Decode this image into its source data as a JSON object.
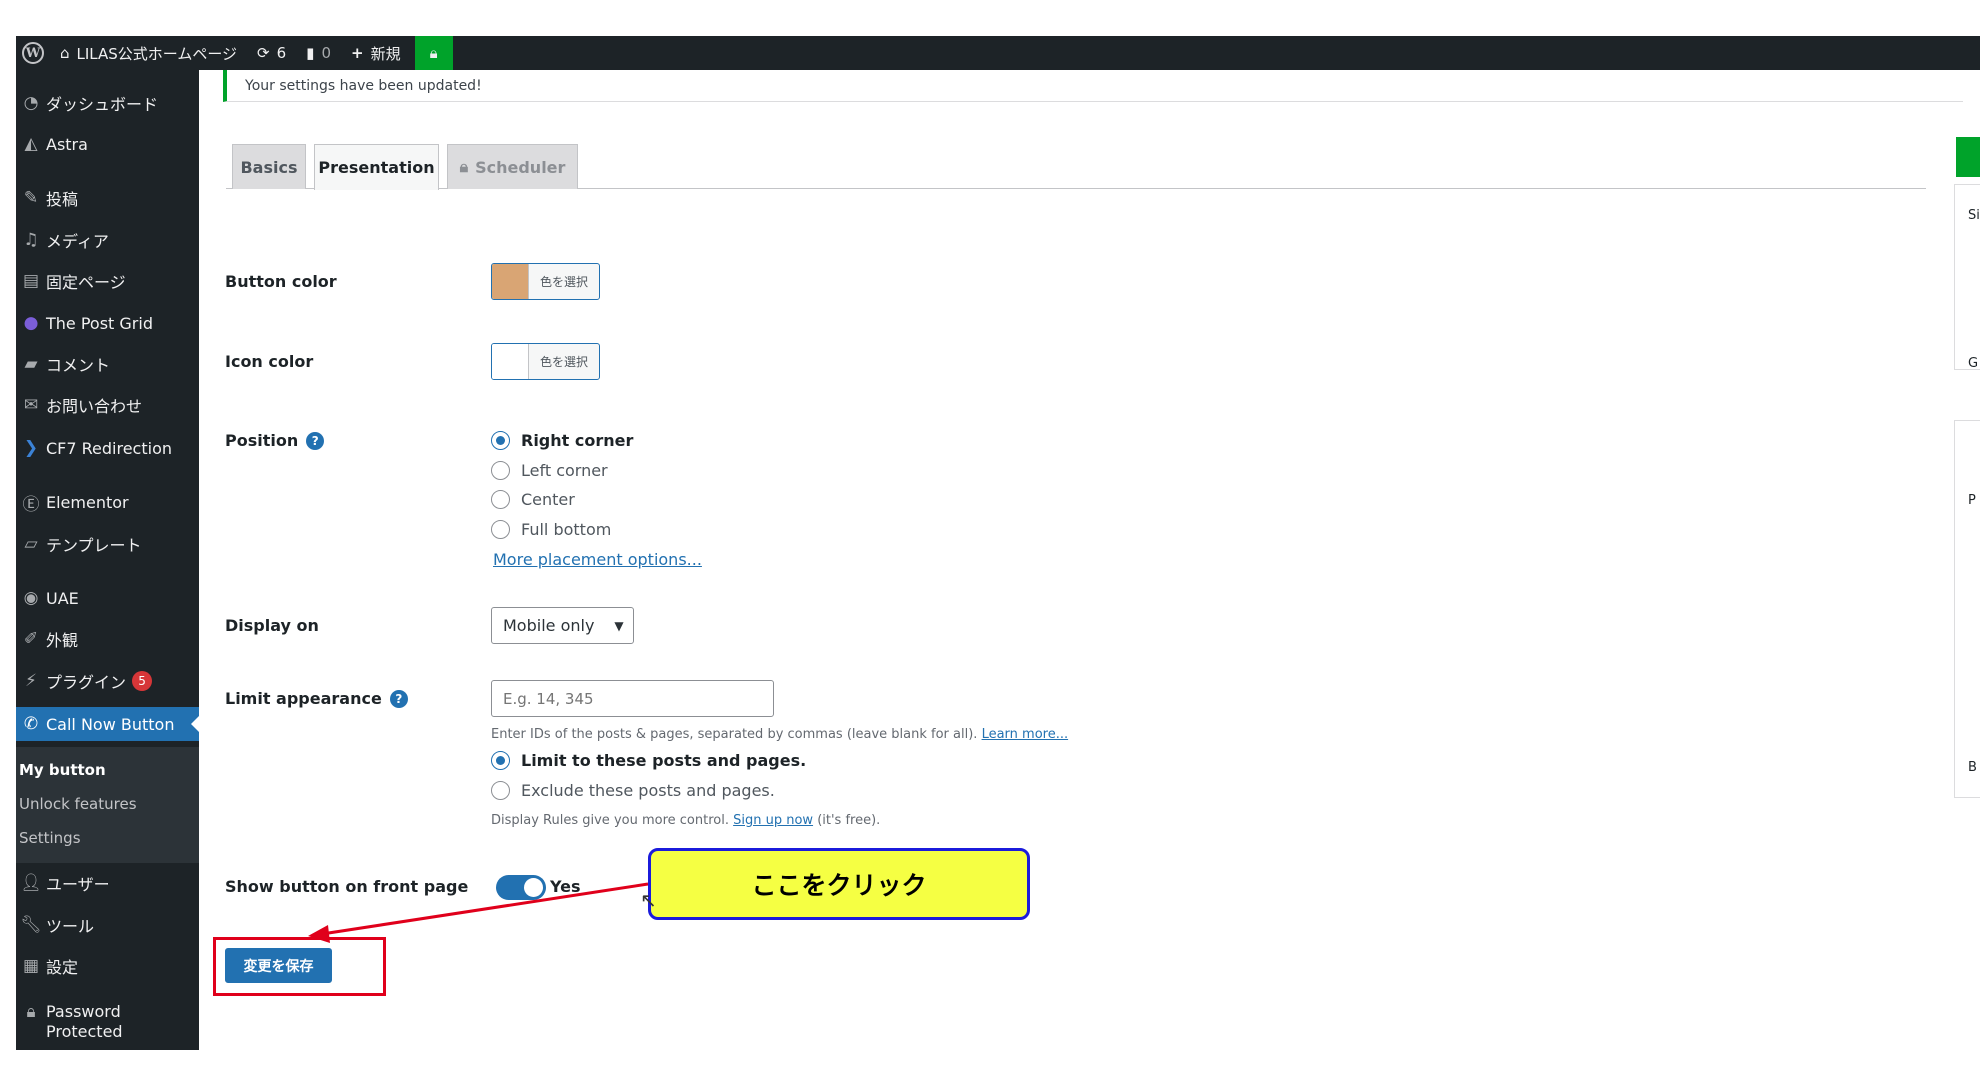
{
  "admin_bar": {
    "site_name": "LILAS公式ホームページ",
    "updates_count": "6",
    "comments_count": "0",
    "new_label": "新規"
  },
  "sidebar": {
    "items": [
      {
        "label": "ダッシュボード",
        "icon": "dashboard-icon"
      },
      {
        "label": "Astra",
        "icon": "astra-icon"
      },
      {
        "label": "投稿",
        "icon": "pin-icon"
      },
      {
        "label": "メディア",
        "icon": "media-icon"
      },
      {
        "label": "固定ページ",
        "icon": "page-icon"
      },
      {
        "label": "The Post Grid",
        "icon": "grid-icon"
      },
      {
        "label": "コメント",
        "icon": "comment-icon"
      },
      {
        "label": "お問い合わせ",
        "icon": "mail-icon"
      },
      {
        "label": "CF7 Redirection",
        "icon": "redirect-icon"
      },
      {
        "label": "Elementor",
        "icon": "elementor-icon"
      },
      {
        "label": "テンプレート",
        "icon": "folder-icon"
      },
      {
        "label": "UAE",
        "icon": "uae-icon"
      },
      {
        "label": "外観",
        "icon": "brush-icon"
      },
      {
        "label": "プラグイン",
        "icon": "plugin-icon",
        "badge": "5"
      },
      {
        "label": "Call Now Button",
        "icon": "phone-icon"
      },
      {
        "label": "ユーザー",
        "icon": "user-icon"
      },
      {
        "label": "ツール",
        "icon": "wrench-icon"
      },
      {
        "label": "設定",
        "icon": "settings-icon"
      },
      {
        "label": "Password Protected",
        "icon": "lock-icon"
      }
    ],
    "submenu": [
      "My button",
      "Unlock features",
      "Settings"
    ]
  },
  "notice": "Your settings have been updated!",
  "tabs": [
    "Basics",
    "Presentation",
    "Scheduler"
  ],
  "form": {
    "button_color_label": "Button color",
    "icon_color_label": "Icon color",
    "color_picker_label": "色を選択",
    "button_color": "#d9a574",
    "icon_color": "#ffffff",
    "position_label": "Position",
    "position_options": [
      "Right corner",
      "Left corner",
      "Center",
      "Full bottom"
    ],
    "position_selected": "Right corner",
    "more_placement": "More placement options...",
    "display_on_label": "Display on",
    "display_on_value": "Mobile only",
    "limit_label": "Limit appearance",
    "limit_placeholder": "E.g. 14, 345",
    "limit_desc_text": "Enter IDs of the posts & pages, separated by commas (leave blank for all).",
    "limit_desc_link": "Learn more...",
    "limit_options": [
      "Limit to these posts and pages.",
      "Exclude these posts and pages."
    ],
    "rules_text_before": "Display Rules give you more control.",
    "rules_link": "Sign up now",
    "rules_text_after": "(it's free).",
    "front_page_label": "Show button on front page",
    "front_page_value": "Yes",
    "save_label": "変更を保存"
  },
  "annotation": {
    "callout_text": "ここをクリック"
  },
  "right_panel": {
    "letters": [
      "Si",
      "G",
      "P",
      "B"
    ]
  }
}
